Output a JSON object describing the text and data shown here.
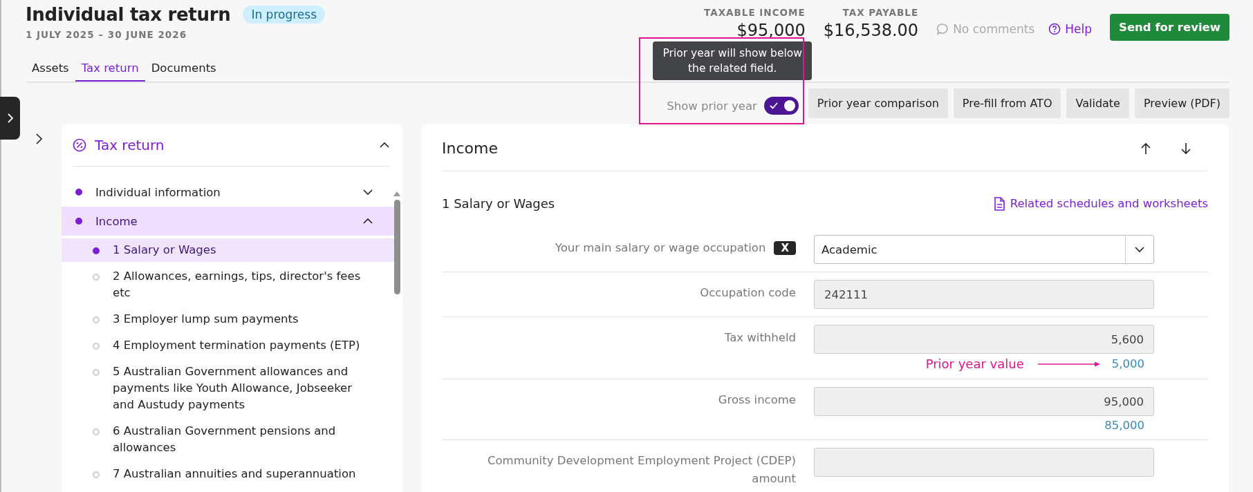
{
  "header": {
    "title": "Individual tax return",
    "status": "In progress",
    "period": "1 JULY 2025 – 30 JUNE 2026",
    "tabs": [
      {
        "label": "Assets",
        "selected": false
      },
      {
        "label": "Tax return",
        "selected": true
      },
      {
        "label": "Documents",
        "selected": false
      }
    ],
    "summary": [
      {
        "label": "TAXABLE INCOME",
        "value": "$95,000"
      },
      {
        "label": "TAX PAYABLE",
        "value": "$16,538.00"
      }
    ],
    "comments": "No comments",
    "help": "Help",
    "primary_button": "Send for review"
  },
  "toolbar": {
    "tooltip": "Prior year will show below the related field.",
    "toggle": {
      "label": "Show prior year",
      "on": true
    },
    "buttons": [
      "Prior year comparison",
      "Pre-fill from ATO",
      "Validate",
      "Preview (PDF)"
    ]
  },
  "sidebar": {
    "title": "Tax return",
    "expanded": true,
    "items": [
      {
        "label": "Individual information",
        "completed": true,
        "expanded": false,
        "selected": false
      },
      {
        "label": "Income",
        "completed": true,
        "expanded": true,
        "selected": true,
        "children": [
          {
            "label": "1 Salary or Wages",
            "completed": true,
            "selected": true
          },
          {
            "label": "2 Allowances, earnings, tips, director's fees etc",
            "completed": false,
            "selected": false
          },
          {
            "label": "3 Employer lump sum payments",
            "completed": false,
            "selected": false
          },
          {
            "label": "4 Employment termination payments (ETP)",
            "completed": false,
            "selected": false
          },
          {
            "label": "5 Australian Government allowances and payments like Youth Allowance, Jobseeker and Austudy payments",
            "completed": false,
            "selected": false
          },
          {
            "label": "6 Australian Government pensions and allowances",
            "completed": false,
            "selected": false
          },
          {
            "label": "7 Australian annuities and superannuation",
            "completed": false,
            "selected": false
          }
        ]
      }
    ]
  },
  "main": {
    "title": "Income",
    "subtitle": "1 Salary or Wages",
    "link": "Related schedules and worksheets",
    "fields": [
      {
        "kind": "select",
        "label": "Your main salary or wage occupation",
        "badge": "X",
        "value": "Academic"
      },
      {
        "kind": "text",
        "label": "Occupation code",
        "value": "242111"
      },
      {
        "kind": "number",
        "label": "Tax withheld",
        "value": "5,600",
        "prior_value": "5,000",
        "annotation": "Prior year value"
      },
      {
        "kind": "number",
        "label": "Gross income",
        "value": "95,000",
        "prior_value": "85,000"
      },
      {
        "kind": "number",
        "label": "Community Development Employment Project (CDEP) amount"
      }
    ]
  }
}
